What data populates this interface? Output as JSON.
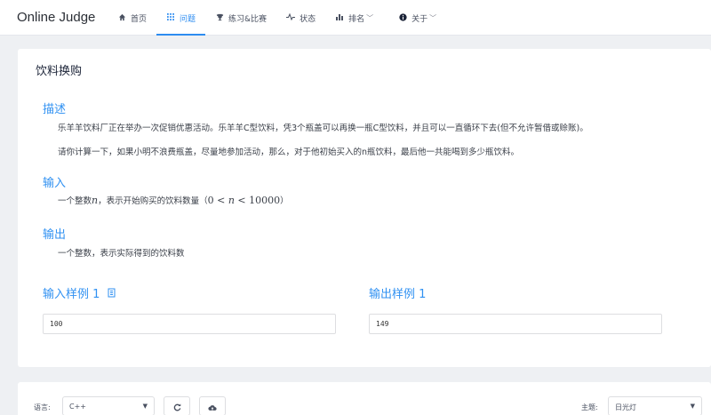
{
  "header": {
    "logo": "Online Judge",
    "nav": [
      {
        "label": "首页",
        "icon": "home-icon",
        "dropdown": false,
        "active": false
      },
      {
        "label": "问题",
        "icon": "grid-icon",
        "dropdown": false,
        "active": true
      },
      {
        "label": "练习&比赛",
        "icon": "trophy-icon",
        "dropdown": false,
        "active": false
      },
      {
        "label": "状态",
        "icon": "pulse-icon",
        "dropdown": false,
        "active": false
      },
      {
        "label": "排名",
        "icon": "bar-chart-icon",
        "dropdown": true,
        "active": false
      },
      {
        "label": "关于",
        "icon": "info-icon",
        "dropdown": true,
        "active": false
      }
    ],
    "accent_color": "#2d8cf0"
  },
  "problem": {
    "title": "饮料换购",
    "description_title": "描述",
    "description": [
      "乐羊羊饮料厂正在举办一次促销优惠活动。乐羊羊C型饮料，凭3个瓶盖可以再换一瓶C型饮料，并且可以一直循环下去(但不允许暂借或赊账)。",
      "请你计算一下，如果小明不浪费瓶盖，尽量地参加活动，那么，对于他初始买入的n瓶饮料，最后他一共能喝到多少瓶饮料。"
    ],
    "input_title": "输入",
    "input_prefix": "一个整数",
    "input_var": "n",
    "input_middle": "，表示开始购买的饮料数量（",
    "input_math_lo": "0 < ",
    "input_math_var": "n",
    "input_math_hi": " < 10000",
    "input_suffix": "）",
    "output_title": "输出",
    "output_text": "一个整数，表示实际得到的饮料数",
    "sample_input_title": "输入样例 1",
    "sample_output_title": "输出样例 1",
    "sample_input": "100",
    "sample_output": "149"
  },
  "editor_bar": {
    "language_label": "语言:",
    "language_value": "C++",
    "theme_label": "主题:",
    "theme_value": "日光灯"
  }
}
